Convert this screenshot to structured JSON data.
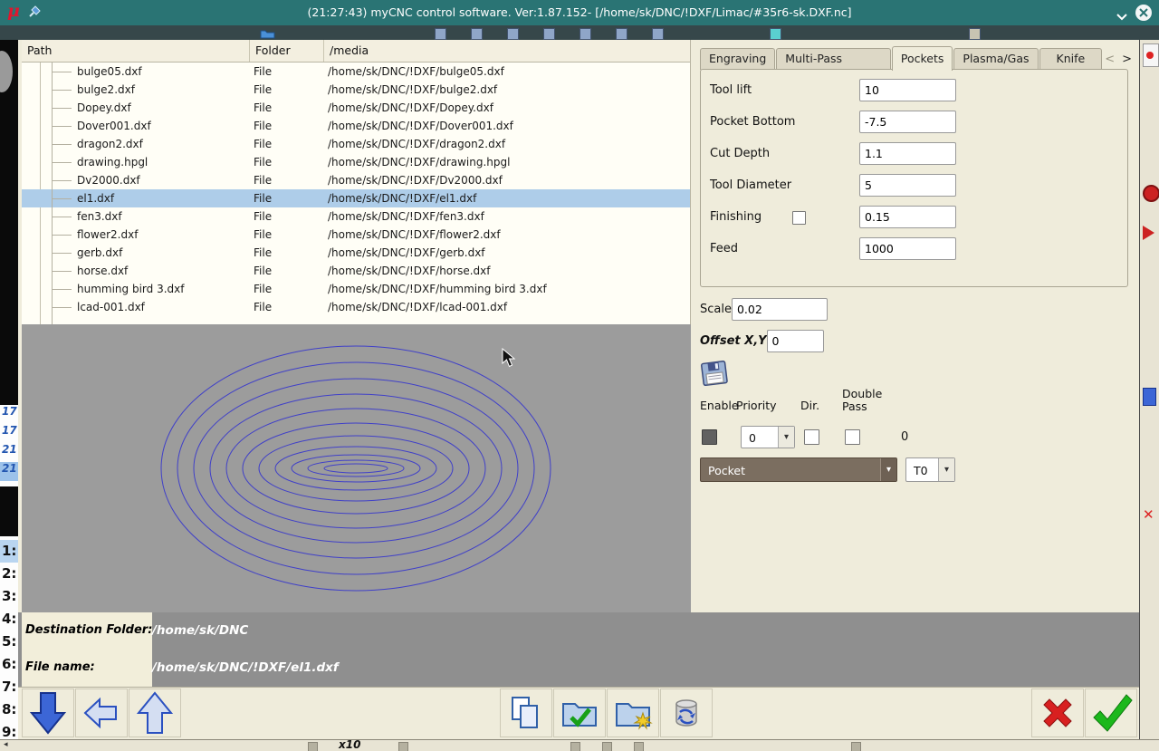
{
  "title_bar": {
    "logo": "μ",
    "title": "(21:27:43)   myCNC control software. Ver:1.87.152-   [/home/sk/DNC/!DXF/Limac/#35r6-sk.DXF.nc]"
  },
  "file_table": {
    "columns": [
      "Path",
      "Folder",
      "/media"
    ],
    "rows": [
      {
        "name": "bulge05.dxf",
        "folder": "File",
        "path": "/home/sk/DNC/!DXF/bulge05.dxf",
        "selected": false
      },
      {
        "name": "bulge2.dxf",
        "folder": "File",
        "path": "/home/sk/DNC/!DXF/bulge2.dxf",
        "selected": false
      },
      {
        "name": "Dopey.dxf",
        "folder": "File",
        "path": "/home/sk/DNC/!DXF/Dopey.dxf",
        "selected": false
      },
      {
        "name": "Dover001.dxf",
        "folder": "File",
        "path": "/home/sk/DNC/!DXF/Dover001.dxf",
        "selected": false
      },
      {
        "name": "dragon2.dxf",
        "folder": "File",
        "path": "/home/sk/DNC/!DXF/dragon2.dxf",
        "selected": false
      },
      {
        "name": "drawing.hpgl",
        "folder": "File",
        "path": "/home/sk/DNC/!DXF/drawing.hpgl",
        "selected": false
      },
      {
        "name": "Dv2000.dxf",
        "folder": "File",
        "path": "/home/sk/DNC/!DXF/Dv2000.dxf",
        "selected": false
      },
      {
        "name": "el1.dxf",
        "folder": "File",
        "path": "/home/sk/DNC/!DXF/el1.dxf",
        "selected": true
      },
      {
        "name": "fen3.dxf",
        "folder": "File",
        "path": "/home/sk/DNC/!DXF/fen3.dxf",
        "selected": false
      },
      {
        "name": "flower2.dxf",
        "folder": "File",
        "path": "/home/sk/DNC/!DXF/flower2.dxf",
        "selected": false
      },
      {
        "name": "gerb.dxf",
        "folder": "File",
        "path": "/home/sk/DNC/!DXF/gerb.dxf",
        "selected": false
      },
      {
        "name": "horse.dxf",
        "folder": "File",
        "path": "/home/sk/DNC/!DXF/horse.dxf",
        "selected": false
      },
      {
        "name": "humming bird 3.dxf",
        "folder": "File",
        "path": "/home/sk/DNC/!DXF/humming bird 3.dxf",
        "selected": false
      },
      {
        "name": "lcad-001.dxf",
        "folder": "File",
        "path": "/home/sk/DNC/!DXF/lcad-001.dxf",
        "selected": false
      }
    ]
  },
  "preview": {
    "stroke": "#4040c8",
    "ellipses": [
      [
        215,
        135
      ],
      [
        197,
        117
      ],
      [
        179,
        99
      ],
      [
        161,
        82
      ],
      [
        143,
        66
      ],
      [
        125,
        50
      ],
      [
        107,
        36
      ],
      [
        89,
        24
      ],
      [
        71,
        15
      ],
      [
        53,
        9
      ],
      [
        35,
        5
      ]
    ]
  },
  "right_panel": {
    "tabs": [
      {
        "label": "Engraving",
        "active": false
      },
      {
        "label": "Multi-Pass Cutting",
        "active": false
      },
      {
        "label": "Pockets",
        "active": true
      },
      {
        "label": "Plasma/Gas",
        "active": false
      },
      {
        "label": "Knife",
        "active": false
      }
    ],
    "tab_prev": "<",
    "tab_next": ">",
    "fields": [
      {
        "label": "Tool lift",
        "value": "10"
      },
      {
        "label": "Pocket Bottom",
        "value": "-7.5"
      },
      {
        "label": "Cut Depth",
        "value": "1.1"
      },
      {
        "label": "Tool Diameter",
        "value": "5"
      },
      {
        "label": "Finishing",
        "value": "0.15",
        "checkbox_checked": false
      },
      {
        "label": "Feed",
        "value": "1000"
      }
    ],
    "scale_label": "Scale",
    "scale_value": "0.02",
    "offset_label": "Offset X,Y",
    "offset_x": "0",
    "offset_y": "0",
    "col_enable": "Enable",
    "col_priority": "Priority",
    "col_dir": "Dir.",
    "col_double_pass": "Double Pass",
    "enable_checked": true,
    "priority_value": "0",
    "dir_checked": false,
    "double_pass_checked": false,
    "pass_count": "0",
    "operation_value": "Pocket",
    "tool_value": "T0"
  },
  "footer": {
    "destination_label": "Destination Folder:",
    "destination_value": "/home/sk/DNC",
    "filename_label": "File name:",
    "filename_value": "/home/sk/DNC/!DXF/el1.dxf"
  },
  "background": {
    "left_counts": [
      "17",
      "17",
      "21",
      "21"
    ],
    "line_numbers": [
      "1:",
      "2:",
      "3:",
      "4:",
      "5:",
      "6:",
      "7:",
      "8:",
      "9:"
    ],
    "x10_label": "x10"
  },
  "icons": {
    "dropdown_arrow": "▾",
    "left_tri": "◂",
    "x_fragment": "✕"
  },
  "colors": {
    "titlebar": "#2a7474",
    "selection": "#aecde9",
    "preview_bg": "#9c9c9c",
    "accent_blue": "#2f5fd0",
    "ok_green": "#1cb81c",
    "cancel_red": "#d82020"
  }
}
